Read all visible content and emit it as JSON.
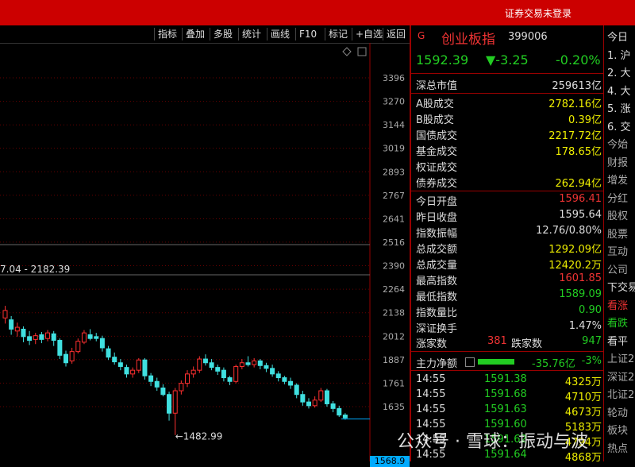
{
  "topbar": {
    "login_status": "证券交易未登录"
  },
  "toolbar": {
    "buttons": [
      "指标",
      "叠加",
      "多股",
      "统计",
      "画线",
      "F10",
      "标记",
      "+自选",
      "返回"
    ]
  },
  "chart": {
    "price_ticks": [
      "3396",
      "3270",
      "3144",
      "3019",
      "2893",
      "2767",
      "2641",
      "2516",
      "2390",
      "2264",
      "2138",
      "2012",
      "1887",
      "1761",
      "1635"
    ],
    "high_note": "7.04 - 2182.39",
    "low_note": "←1482.99",
    "current_price": "1568.9",
    "candles": [
      {
        "o": 2110,
        "c": 2150,
        "h": 2175,
        "l": 2080
      },
      {
        "o": 2100,
        "c": 2050,
        "h": 2120,
        "l": 2020
      },
      {
        "o": 2040,
        "c": 2060,
        "h": 2085,
        "l": 2010
      },
      {
        "o": 2050,
        "c": 2010,
        "h": 2065,
        "l": 1980
      },
      {
        "o": 2010,
        "c": 1990,
        "h": 2040,
        "l": 1965
      },
      {
        "o": 1995,
        "c": 2015,
        "h": 2030,
        "l": 1970
      },
      {
        "o": 2020,
        "c": 1995,
        "h": 2035,
        "l": 1975
      },
      {
        "o": 2000,
        "c": 2030,
        "h": 2045,
        "l": 1985
      },
      {
        "o": 2025,
        "c": 1990,
        "h": 2040,
        "l": 1960
      },
      {
        "o": 1990,
        "c": 1910,
        "h": 2000,
        "l": 1890
      },
      {
        "o": 1915,
        "c": 1870,
        "h": 1935,
        "l": 1850
      },
      {
        "o": 1880,
        "c": 1930,
        "h": 1950,
        "l": 1865
      },
      {
        "o": 1930,
        "c": 1985,
        "h": 2000,
        "l": 1920
      },
      {
        "o": 1980,
        "c": 2030,
        "h": 2045,
        "l": 1970
      },
      {
        "o": 2020,
        "c": 2000,
        "h": 2050,
        "l": 1990
      },
      {
        "o": 2010,
        "c": 2000,
        "h": 2030,
        "l": 1985
      },
      {
        "o": 2000,
        "c": 1950,
        "h": 2015,
        "l": 1930
      },
      {
        "o": 1945,
        "c": 1900,
        "h": 1960,
        "l": 1885
      },
      {
        "o": 1900,
        "c": 1875,
        "h": 1925,
        "l": 1860
      },
      {
        "o": 1870,
        "c": 1850,
        "h": 1890,
        "l": 1830
      },
      {
        "o": 1845,
        "c": 1810,
        "h": 1860,
        "l": 1790
      },
      {
        "o": 1810,
        "c": 1830,
        "h": 1845,
        "l": 1790
      },
      {
        "o": 1830,
        "c": 1885,
        "h": 1895,
        "l": 1815
      },
      {
        "o": 1885,
        "c": 1800,
        "h": 1895,
        "l": 1780
      },
      {
        "o": 1800,
        "c": 1770,
        "h": 1815,
        "l": 1745
      },
      {
        "o": 1770,
        "c": 1740,
        "h": 1790,
        "l": 1720
      },
      {
        "o": 1735,
        "c": 1700,
        "h": 1755,
        "l": 1690
      },
      {
        "o": 1700,
        "c": 1600,
        "h": 1715,
        "l": 1560
      },
      {
        "o": 1600,
        "c": 1720,
        "h": 1735,
        "l": 1483
      },
      {
        "o": 1720,
        "c": 1760,
        "h": 1775,
        "l": 1700
      },
      {
        "o": 1760,
        "c": 1810,
        "h": 1830,
        "l": 1740
      },
      {
        "o": 1810,
        "c": 1830,
        "h": 1850,
        "l": 1790
      },
      {
        "o": 1830,
        "c": 1890,
        "h": 1905,
        "l": 1815
      },
      {
        "o": 1890,
        "c": 1870,
        "h": 1915,
        "l": 1855
      },
      {
        "o": 1870,
        "c": 1845,
        "h": 1890,
        "l": 1830
      },
      {
        "o": 1845,
        "c": 1825,
        "h": 1860,
        "l": 1805
      },
      {
        "o": 1830,
        "c": 1790,
        "h": 1845,
        "l": 1770
      },
      {
        "o": 1790,
        "c": 1770,
        "h": 1800,
        "l": 1750
      },
      {
        "o": 1770,
        "c": 1850,
        "h": 1860,
        "l": 1760
      },
      {
        "o": 1850,
        "c": 1870,
        "h": 1890,
        "l": 1835
      },
      {
        "o": 1870,
        "c": 1860,
        "h": 1905,
        "l": 1850
      },
      {
        "o": 1860,
        "c": 1880,
        "h": 1895,
        "l": 1845
      },
      {
        "o": 1880,
        "c": 1855,
        "h": 1890,
        "l": 1835
      },
      {
        "o": 1855,
        "c": 1840,
        "h": 1870,
        "l": 1820
      },
      {
        "o": 1840,
        "c": 1810,
        "h": 1860,
        "l": 1795
      },
      {
        "o": 1810,
        "c": 1790,
        "h": 1825,
        "l": 1770
      },
      {
        "o": 1790,
        "c": 1770,
        "h": 1800,
        "l": 1755
      },
      {
        "o": 1770,
        "c": 1750,
        "h": 1790,
        "l": 1730
      },
      {
        "o": 1750,
        "c": 1700,
        "h": 1760,
        "l": 1680
      },
      {
        "o": 1700,
        "c": 1660,
        "h": 1720,
        "l": 1640
      },
      {
        "o": 1660,
        "c": 1640,
        "h": 1680,
        "l": 1625
      },
      {
        "o": 1640,
        "c": 1670,
        "h": 1690,
        "l": 1630
      },
      {
        "o": 1670,
        "c": 1720,
        "h": 1735,
        "l": 1660
      },
      {
        "o": 1720,
        "c": 1650,
        "h": 1730,
        "l": 1635
      },
      {
        "o": 1650,
        "c": 1625,
        "h": 1665,
        "l": 1605
      },
      {
        "o": 1625,
        "c": 1590,
        "h": 1640,
        "l": 1580
      },
      {
        "o": 1590,
        "c": 1575,
        "h": 1600,
        "l": 1565
      }
    ]
  },
  "index": {
    "g_label": "G",
    "name": "创业板指",
    "code": "399006",
    "price": "1592.39",
    "change": "▼-3.25",
    "pct": "-0.20%"
  },
  "stats1": [
    {
      "label": "深总市值",
      "value": "259613亿",
      "color": "#ddd"
    }
  ],
  "stats2": [
    {
      "label": "A股成交",
      "value": "2782.16亿",
      "color": "#ee0"
    },
    {
      "label": "B股成交",
      "value": "0.39亿",
      "color": "#ee0"
    },
    {
      "label": "国债成交",
      "value": "2217.72亿",
      "color": "#ee0"
    },
    {
      "label": "基金成交",
      "value": "178.65亿",
      "color": "#ee0"
    },
    {
      "label": "权证成交",
      "value": "",
      "color": "#ee0"
    },
    {
      "label": "债券成交",
      "value": "262.94亿",
      "color": "#ee0"
    }
  ],
  "stats3": [
    {
      "label": "今日开盘",
      "value": "1596.41",
      "color": "#e33"
    },
    {
      "label": "昨日收盘",
      "value": "1595.64",
      "color": "#ddd"
    },
    {
      "label": "指数振幅",
      "value": "12.76/0.80%",
      "color": "#ddd"
    },
    {
      "label": "总成交额",
      "value": "1292.09亿",
      "color": "#ee0"
    },
    {
      "label": "总成交量",
      "value": "12420.2万",
      "color": "#ee0"
    },
    {
      "label": "最高指数",
      "value": "1601.85",
      "color": "#e33"
    },
    {
      "label": "最低指数",
      "value": "1589.09",
      "color": "#2c2"
    },
    {
      "label": "指数量比",
      "value": "0.90",
      "color": "#2c2"
    },
    {
      "label": "深证换手",
      "value": "1.47%",
      "color": "#ddd"
    }
  ],
  "breadth": {
    "up_label": "涨家数",
    "up": "381",
    "down_label": "跌家数",
    "down": "947"
  },
  "netflow": {
    "label": "主力净额",
    "value": "-35.76亿",
    "pct": "-3%"
  },
  "ticks": [
    {
      "t": "14:55",
      "p": "1591.38",
      "v": "4325万"
    },
    {
      "t": "14:55",
      "p": "1591.68",
      "v": "4710万"
    },
    {
      "t": "14:55",
      "p": "1591.63",
      "v": "4673万"
    },
    {
      "t": "14:55",
      "p": "1591.60",
      "v": "5183万"
    },
    {
      "t": "14:55",
      "p": "1591.62",
      "v": "4794万"
    },
    {
      "t": "14:55",
      "p": "1591.64",
      "v": "4868万"
    }
  ],
  "right_panel": [
    {
      "text": "今日",
      "color": "#ddd"
    },
    {
      "text": "1. 沪",
      "color": "#ddd"
    },
    {
      "text": "2. 大",
      "color": "#ddd"
    },
    {
      "text": "4. 大",
      "color": "#ddd"
    },
    {
      "text": "5. 涨",
      "color": "#ddd"
    },
    {
      "text": "6. 交",
      "color": "#ddd"
    },
    {
      "text": "今始",
      "color": "#aaa"
    },
    {
      "text": "财报",
      "color": "#aaa"
    },
    {
      "text": "增发",
      "color": "#aaa"
    },
    {
      "text": "分红",
      "color": "#aaa"
    },
    {
      "text": "股权",
      "color": "#aaa"
    },
    {
      "text": "股票",
      "color": "#aaa"
    },
    {
      "text": "互动",
      "color": "#aaa"
    },
    {
      "text": "公司",
      "color": "#aaa"
    },
    {
      "text": "下交易",
      "color": "#ddd"
    },
    {
      "text": "看涨",
      "color": "#e33"
    },
    {
      "text": "看跌",
      "color": "#2c2"
    },
    {
      "text": "看平",
      "color": "#ddd"
    },
    {
      "text": "上证2",
      "color": "#aaa"
    },
    {
      "text": "深证2",
      "color": "#aaa"
    },
    {
      "text": "北证2",
      "color": "#aaa"
    },
    {
      "text": "轮动",
      "color": "#aaa"
    },
    {
      "text": "板块",
      "color": "#aaa"
    },
    {
      "text": "热点",
      "color": "#aaa"
    }
  ],
  "watermark": "公众号 · 雪球：振动与波"
}
